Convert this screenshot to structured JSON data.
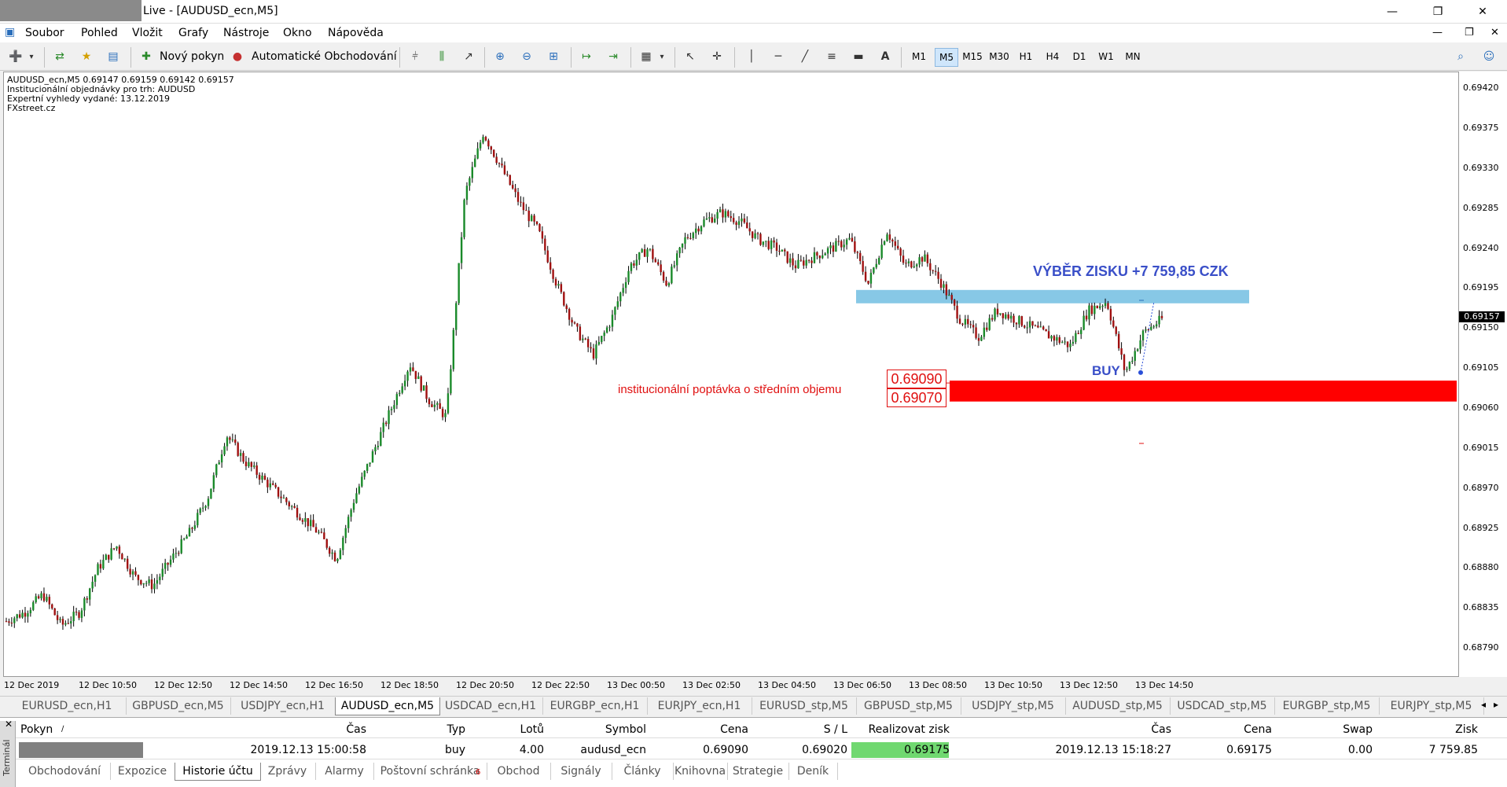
{
  "window": {
    "title": "Live - [AUDUSD_ecn,M5]"
  },
  "menu": [
    "Soubor",
    "Pohled",
    "Vložit",
    "Grafy",
    "Nástroje",
    "Okno",
    "Nápověda"
  ],
  "toolbar": {
    "new_order": "Nový pokyn",
    "auto_trading": "Automatické Obchodování",
    "timeframes": [
      "M1",
      "M5",
      "M15",
      "M30",
      "H1",
      "H4",
      "D1",
      "W1",
      "MN"
    ],
    "active_timeframe": "M5"
  },
  "chart_info": {
    "line1": "AUDUSD_ecn,M5  0.69147 0.69159 0.69142 0.69157",
    "line2": "Institucionální objednávky pro trh: AUDUSD",
    "line3": "Expertní vyhledy vydané: 13.12.2019",
    "line4": "FXstreet.cz"
  },
  "annotations": {
    "profit": "VÝBĚR ZISKU +7 759,85 CZK",
    "buy": "BUY",
    "demand": "institucionální poptávka o středním objemu",
    "zone_top": "0.69090",
    "zone_bottom": "0.69070",
    "current_price": "0.69157"
  },
  "chart_data": {
    "type": "candlestick",
    "symbol": "AUDUSD_ecn",
    "timeframe": "M5",
    "ylim": [
      0.68775,
      0.6943
    ],
    "y_ticks": [
      "0.69420",
      "0.69375",
      "0.69330",
      "0.69285",
      "0.69240",
      "0.69195",
      "0.69150",
      "0.69105",
      "0.69060",
      "0.69015",
      "0.68970",
      "0.68925",
      "0.68880",
      "0.68835",
      "0.68790"
    ],
    "x_ticks": [
      "12 Dec 2019",
      "12 Dec 10:50",
      "12 Dec 12:50",
      "12 Dec 14:50",
      "12 Dec 16:50",
      "12 Dec 18:50",
      "12 Dec 20:50",
      "12 Dec 22:50",
      "13 Dec 00:50",
      "13 Dec 02:50",
      "13 Dec 04:50",
      "13 Dec 06:50",
      "13 Dec 08:50",
      "13 Dec 10:50",
      "13 Dec 12:50",
      "13 Dec 14:50"
    ],
    "price_path": [
      0.6882,
      0.6883,
      0.6885,
      0.68815,
      0.6883,
      0.6888,
      0.68905,
      0.6887,
      0.6886,
      0.6889,
      0.6892,
      0.6896,
      0.6903,
      0.69,
      0.6898,
      0.6896,
      0.6894,
      0.6892,
      0.6889,
      0.6896,
      0.6901,
      0.6906,
      0.6911,
      0.6907,
      0.6905,
      0.693,
      0.6937,
      0.6933,
      0.6929,
      0.6926,
      0.692,
      0.6915,
      0.6912,
      0.6916,
      0.6922,
      0.6924,
      0.692,
      0.6925,
      0.6927,
      0.6928,
      0.6927,
      0.6925,
      0.6924,
      0.6922,
      0.6923,
      0.6924,
      0.6925,
      0.692,
      0.6926,
      0.6922,
      0.6923,
      0.692,
      0.6916,
      0.6914,
      0.6917,
      0.6916,
      0.6915,
      0.6914,
      0.6913,
      0.6917,
      0.6918,
      0.691,
      0.69145,
      0.6916
    ],
    "zones": {
      "take_profit": 0.69185,
      "demand_top": 0.6909,
      "demand_bottom": 0.6907
    }
  },
  "chart_tabs": [
    "EURUSD_ecn,H1",
    "GBPUSD_ecn,M5",
    "USDJPY_ecn,H1",
    "AUDUSD_ecn,M5",
    "USDCAD_ecn,H1",
    "EURGBP_ecn,H1",
    "EURJPY_ecn,H1",
    "EURUSD_stp,M5",
    "GBPUSD_stp,M5",
    "USDJPY_stp,M5",
    "AUDUSD_stp,M5",
    "USDCAD_stp,M5",
    "EURGBP_stp,M5",
    "EURJPY_stp,M5"
  ],
  "active_chart_tab": "AUDUSD_ecn,M5",
  "terminal": {
    "side_label": "Terminál",
    "headers": [
      "Pokyn",
      "Čas",
      "Typ",
      "Lotů",
      "Symbol",
      "Cena",
      "S / L",
      "Realizovat zisk",
      "Čas",
      "Cena",
      "Swap",
      "Zisk"
    ],
    "row": [
      "",
      "2019.12.13 15:00:58",
      "buy",
      "4.00",
      "audusd_ecn",
      "0.69090",
      "0.69020",
      "0.69175",
      "2019.12.13 15:18:27",
      "0.69175",
      "0.00",
      "7 759.85"
    ],
    "tabs": [
      "Obchodování",
      "Expozice",
      "Historie účtu",
      "Zprávy",
      "Alarmy",
      "Poštovní schránka",
      "Obchod",
      "Signály",
      "Články",
      "Knihovna",
      "Strategie",
      "Deník"
    ],
    "mailbox_badge": "6",
    "active_tab": "Historie účtu"
  }
}
